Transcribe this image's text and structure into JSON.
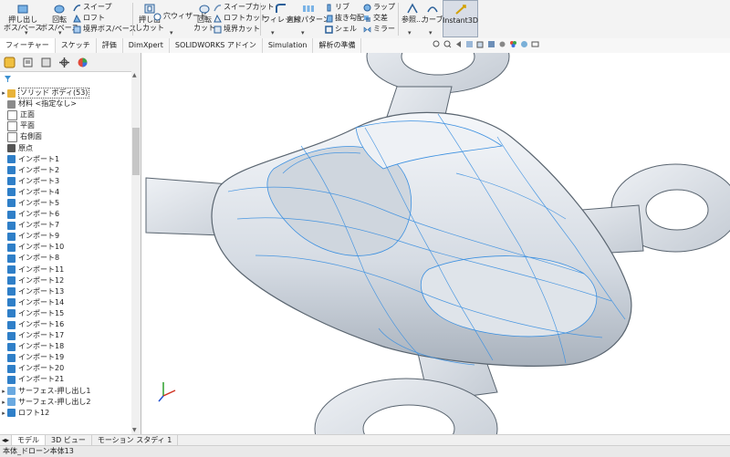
{
  "ribbon": {
    "extrude_boss": "押し出し\nボス/ベース",
    "revolve_boss": "回転\nボス/ベース",
    "sweep": "スイープ",
    "loft": "ロフト",
    "boundary_boss": "境界ボス/ベース",
    "extrude_cut": "押し出\nしカット",
    "hole_wizard": "穴ウィザード",
    "revolve_cut": "回転\nカット",
    "sweep_cut": "スイープカット",
    "loft_cut": "ロフトカット",
    "boundary_cut": "境界カット",
    "fillet": "フィレット",
    "linear_pattern": "直線パターン",
    "rib": "リブ",
    "draft": "抜き勾配",
    "shell": "シェル",
    "wrap": "ラップ",
    "intersect": "交差",
    "mirror": "ミラー",
    "reference": "参照...",
    "curves": "カーブ",
    "instant3d": "Instant3D"
  },
  "tabs": [
    {
      "label": "フィーチャー",
      "active": true
    },
    {
      "label": "スケッチ",
      "active": false
    },
    {
      "label": "評価",
      "active": false
    },
    {
      "label": "DimXpert",
      "active": false
    },
    {
      "label": "SOLIDWORKS アドイン",
      "active": false
    },
    {
      "label": "Simulation",
      "active": false
    },
    {
      "label": "解析の準備",
      "active": false
    }
  ],
  "tree": [
    {
      "label": "ソリッド ボディ(53)",
      "icon": "solid-bodies-icon",
      "arrow": "▸",
      "selected": true
    },
    {
      "label": "材料 <指定なし>",
      "icon": "material-icon",
      "arrow": ""
    },
    {
      "label": "正面",
      "icon": "plane-icon",
      "arrow": ""
    },
    {
      "label": "平面",
      "icon": "plane-icon",
      "arrow": ""
    },
    {
      "label": "右側面",
      "icon": "plane-icon",
      "arrow": ""
    },
    {
      "label": "原点",
      "icon": "origin-icon",
      "arrow": ""
    },
    {
      "label": "インポート1",
      "icon": "import-icon",
      "arrow": ""
    },
    {
      "label": "インポート2",
      "icon": "import-icon",
      "arrow": ""
    },
    {
      "label": "インポート3",
      "icon": "import-icon",
      "arrow": ""
    },
    {
      "label": "インポート4",
      "icon": "import-icon",
      "arrow": ""
    },
    {
      "label": "インポート5",
      "icon": "import-icon",
      "arrow": ""
    },
    {
      "label": "インポート6",
      "icon": "import-icon",
      "arrow": ""
    },
    {
      "label": "インポート7",
      "icon": "import-icon",
      "arrow": ""
    },
    {
      "label": "インポート9",
      "icon": "import-icon",
      "arrow": ""
    },
    {
      "label": "インポート10",
      "icon": "import-icon",
      "arrow": ""
    },
    {
      "label": "インポート8",
      "icon": "import-icon",
      "arrow": ""
    },
    {
      "label": "インポート11",
      "icon": "import-icon",
      "arrow": ""
    },
    {
      "label": "インポート12",
      "icon": "import-icon",
      "arrow": ""
    },
    {
      "label": "インポート13",
      "icon": "import-icon",
      "arrow": ""
    },
    {
      "label": "インポート14",
      "icon": "import-icon",
      "arrow": ""
    },
    {
      "label": "インポート15",
      "icon": "import-icon",
      "arrow": ""
    },
    {
      "label": "インポート16",
      "icon": "import-icon",
      "arrow": ""
    },
    {
      "label": "インポート17",
      "icon": "import-icon",
      "arrow": ""
    },
    {
      "label": "インポート18",
      "icon": "import-icon",
      "arrow": ""
    },
    {
      "label": "インポート19",
      "icon": "import-icon",
      "arrow": ""
    },
    {
      "label": "インポート20",
      "icon": "import-icon",
      "arrow": ""
    },
    {
      "label": "インポート21",
      "icon": "import-icon",
      "arrow": ""
    },
    {
      "label": "サーフェス-押し出し1",
      "icon": "surface-icon",
      "arrow": "▸"
    },
    {
      "label": "サーフェス-押し出し2",
      "icon": "surface-icon",
      "arrow": "▸"
    },
    {
      "label": "ロフト12",
      "icon": "loft-icon",
      "arrow": "▸"
    }
  ],
  "bottom_tabs": [
    {
      "label": "モデル",
      "active": true
    },
    {
      "label": "3D ビュー",
      "active": false
    },
    {
      "label": "モーション スタディ 1",
      "active": false
    }
  ],
  "status": {
    "text": "本体_ドローン本体13"
  },
  "colors": {
    "accent": "#1f7bd8",
    "wire": "#3a8fe0",
    "body": "#eef1f5"
  }
}
